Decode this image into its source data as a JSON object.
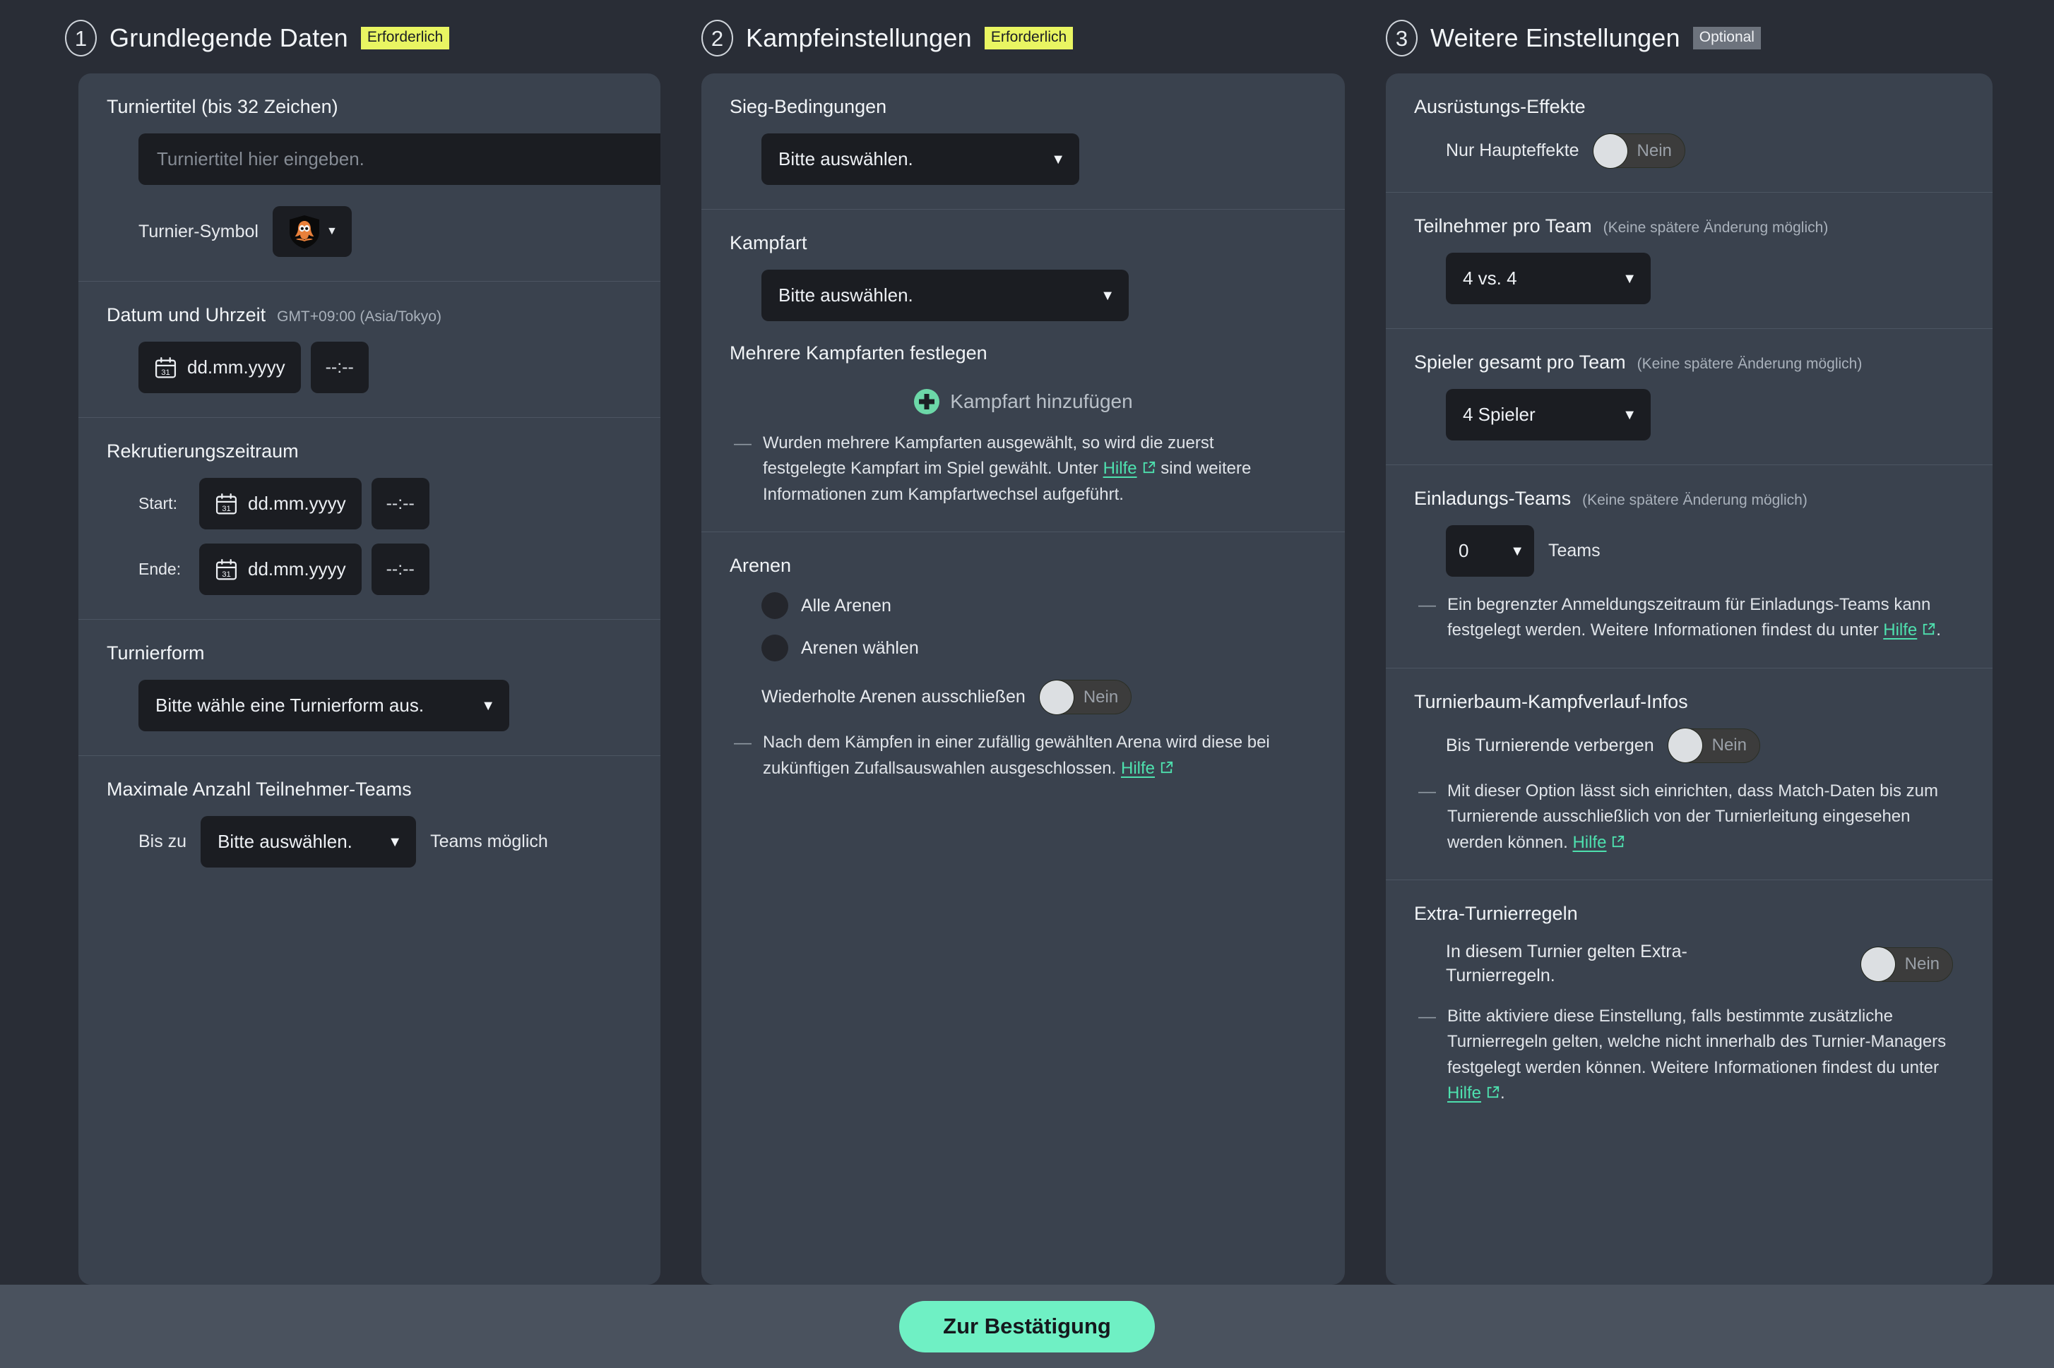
{
  "columns": [
    {
      "step": "1",
      "title": "Grundlegende Daten",
      "badge": "Erforderlich",
      "badge_type": "required"
    },
    {
      "step": "2",
      "title": "Kampfeinstellungen",
      "badge": "Erforderlich",
      "badge_type": "required"
    },
    {
      "step": "3",
      "title": "Weitere Einstellungen",
      "badge": "Optional",
      "badge_type": "optional"
    }
  ],
  "col1": {
    "title_section": {
      "label": "Turniertitel (bis 32 Zeichen)",
      "input_value": "",
      "input_placeholder": "Turniertitel hier eingeben.",
      "symbol_label": "Turnier-Symbol",
      "symbol_icon": "orange-squid-shield-icon",
      "symbol_caret": "▼"
    },
    "datetime_section": {
      "label": "Datum und Uhrzeit",
      "timezone": "GMT+09:00 (Asia/Tokyo)",
      "date_placeholder": "dd.mm.yyyy",
      "time_placeholder": "--:--",
      "calendar_day": "31"
    },
    "recruit_section": {
      "label": "Rekrutierungszeitraum",
      "start_label": "Start:",
      "end_label": "Ende:",
      "date_placeholder": "dd.mm.yyyy",
      "time_placeholder": "--:--",
      "calendar_day": "31"
    },
    "form_section": {
      "label": "Turnierform",
      "select_value": "Bitte wähle eine Turnierform aus.",
      "caret": "▼"
    },
    "max_teams_section": {
      "label": "Maximale Anzahl Teilnehmer-Teams",
      "prefix": "Bis zu",
      "select_value": "Bitte auswählen.",
      "caret": "▼",
      "suffix": "Teams möglich"
    }
  },
  "col2": {
    "victory_section": {
      "label": "Sieg-Bedingungen",
      "select_value": "Bitte auswählen.",
      "caret": "▼"
    },
    "battle_section": {
      "label": "Kampfart",
      "select_value": "Bitte auswählen.",
      "caret": "▼",
      "multi_label": "Mehrere Kampfarten festlegen",
      "add_label": "Kampfart hinzufügen",
      "add_icon": "plus-circle-icon",
      "note_part1": "Wurden mehrere Kampfarten ausgewählt, so wird die zuerst festgelegte Kampfart im Spiel gewählt. Unter ",
      "note_link": "Hilfe",
      "note_part2": " sind weitere Informationen zum Kampfartwechsel aufgeführt."
    },
    "arena_section": {
      "label": "Arenen",
      "radio_all": "Alle Arenen",
      "radio_select": "Arenen wählen",
      "exclude_label": "Wiederholte Arenen ausschließen",
      "exclude_toggle": "Nein",
      "note_part1": "Nach dem Kämpfen in einer zufällig gewählten Arena wird diese bei zukünftigen Zufallsauswahlen ausgeschlossen. ",
      "note_link": "Hilfe",
      "note_part2": ""
    }
  },
  "col3": {
    "gear_section": {
      "label": "Ausrüstungs-Effekte",
      "toggle_label": "Nur Haupteffekte",
      "toggle_value": "Nein"
    },
    "participants_section": {
      "label": "Teilnehmer pro Team",
      "hint": "(Keine spätere Änderung möglich)",
      "select_value": "4 vs. 4",
      "caret": "▼"
    },
    "players_section": {
      "label": "Spieler gesamt pro Team",
      "hint": "(Keine spätere Änderung möglich)",
      "select_value": "4 Spieler",
      "caret": "▼"
    },
    "invite_section": {
      "label": "Einladungs-Teams",
      "hint": "(Keine spätere Änderung möglich)",
      "select_value": "0",
      "caret": "▼",
      "suffix": "Teams",
      "note_part1": "Ein begrenzter Anmeldungszeitraum für Einladungs-Teams kann festgelegt werden. Weitere Informationen findest du unter ",
      "note_link": "Hilfe",
      "note_part2": "."
    },
    "bracket_section": {
      "label": "Turnierbaum-Kampfverlauf-Infos",
      "toggle_label": "Bis Turnierende verbergen",
      "toggle_value": "Nein",
      "note_part1": "Mit dieser Option lässt sich einrichten, dass Match-Daten bis zum Turnierende ausschließlich von der Turnierleitung eingesehen werden können. ",
      "note_link": "Hilfe",
      "note_part2": ""
    },
    "extra_rules_section": {
      "label": "Extra-Turnierregeln",
      "toggle_label": "In diesem Turnier gelten Extra-Turnierregeln.",
      "toggle_value": "Nein",
      "note_part1": "Bitte aktiviere diese Einstellung, falls bestimmte zusätzliche Turnierregeln gelten, welche nicht innerhalb des Turnier-Managers festgelegt werden können. Weitere Informationen findest du unter ",
      "note_link": "Hilfe",
      "note_part2": "."
    }
  },
  "footer": {
    "confirm_label": "Zur Bestätigung"
  },
  "colors": {
    "page_bg": "#292d36",
    "panel_bg": "#3a424e",
    "input_bg": "#1b1d22",
    "accent_mint": "#6ff0c4",
    "link_green": "#4ee0ae",
    "badge_required": "#e9f562",
    "badge_optional": "#6d737d",
    "footer_bg": "#4a525e"
  }
}
